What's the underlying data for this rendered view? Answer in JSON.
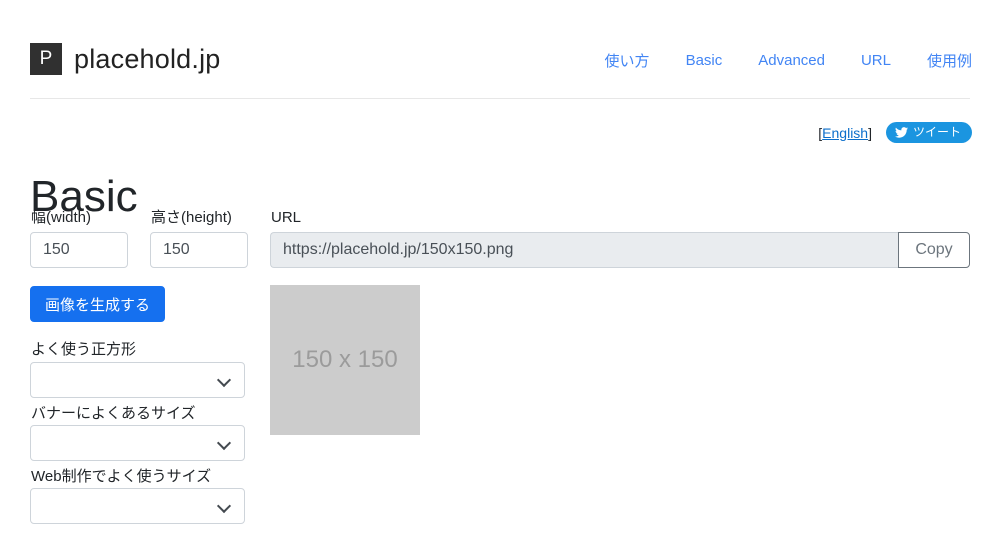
{
  "header": {
    "brand_mark": "P",
    "brand_name": "placehold.jp",
    "nav": [
      {
        "label": "使い方",
        "name": "nav-howto"
      },
      {
        "label": "Basic",
        "name": "nav-basic"
      },
      {
        "label": "Advanced",
        "name": "nav-advanced"
      },
      {
        "label": "URL",
        "name": "nav-url"
      },
      {
        "label": "使用例",
        "name": "nav-examples"
      }
    ]
  },
  "utility": {
    "lang_open_bracket": "[",
    "lang_link": "English",
    "lang_close_bracket": "]",
    "tweet_label": "ツイート",
    "tweet_icon": "twitter-bird-icon",
    "tweet_bg": "#1b95e0"
  },
  "page": {
    "title": "Basic"
  },
  "form": {
    "width_label": "幅(width)",
    "width_value": "150",
    "height_label": "高さ(height)",
    "height_value": "150",
    "url_label": "URL",
    "url_value": "https://placehold.jp/150x150.png",
    "copy_label": "Copy",
    "generate_label": "画像を生成する",
    "generate_bg": "#1570ef",
    "square_label": "よく使う正方形",
    "square_value": "",
    "banner_label": "バナーによくあるサイズ",
    "banner_value": "",
    "web_label": "Web制作でよく使うサイズ",
    "web_value": ""
  },
  "preview": {
    "text": "150 x 150",
    "bg": "#cccccc",
    "fg": "#9b9b9b"
  }
}
